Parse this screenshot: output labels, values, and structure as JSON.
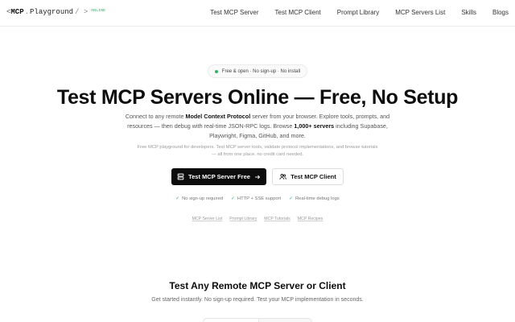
{
  "logo": {
    "open": "<",
    "brand": "MCP",
    "dot": ".",
    "name": "Playground",
    "close": "/ >",
    "status": "ONLINE"
  },
  "nav": {
    "links": [
      "Test MCP Server",
      "Test MCP Client",
      "Prompt Library",
      "MCP Servers List",
      "Skills",
      "Blogs"
    ]
  },
  "hero": {
    "pill": "Free & open · No sign-up · No install",
    "title": "Test MCP Servers Online — Free, No Setup",
    "desc_part1": "Connect to any remote ",
    "desc_bold1": "Model Context Protocol",
    "desc_part2": " server from your browser. Explore tools, prompts, and resources — then debug with real-time JSON-RPC logs. Browse ",
    "desc_bold2": "1,000+ servers",
    "desc_part3": " including Supabase, Playwright, Figma, GitHub, and more.",
    "sub": "Free MCP playground for developers. Test MCP server tools, validate protocol implementations, and browse tutorials — all from one place, no credit card needed."
  },
  "buttons": {
    "primary": "Test MCP Server Free",
    "secondary": "Test MCP Client"
  },
  "features": [
    "No sign-up required",
    "HTTP + SSE support",
    "Real-time debug logs"
  ],
  "quick_links": [
    "MCP Server List",
    "Prompt Library",
    "MCP Tutorials",
    "MCP Recipes"
  ],
  "section": {
    "title": "Test Any Remote MCP Server or Client",
    "subtitle": "Get started instantly. No sign-up required. Test your MCP implementation in seconds."
  },
  "colors": {
    "accent_green": "#2fb56a",
    "primary_button": "#0d0d0d"
  },
  "icons": {
    "primary_button_left": "server-icon",
    "primary_button_right": "arrow-right-icon",
    "secondary_button": "users-icon",
    "feature_check": "check-icon"
  }
}
